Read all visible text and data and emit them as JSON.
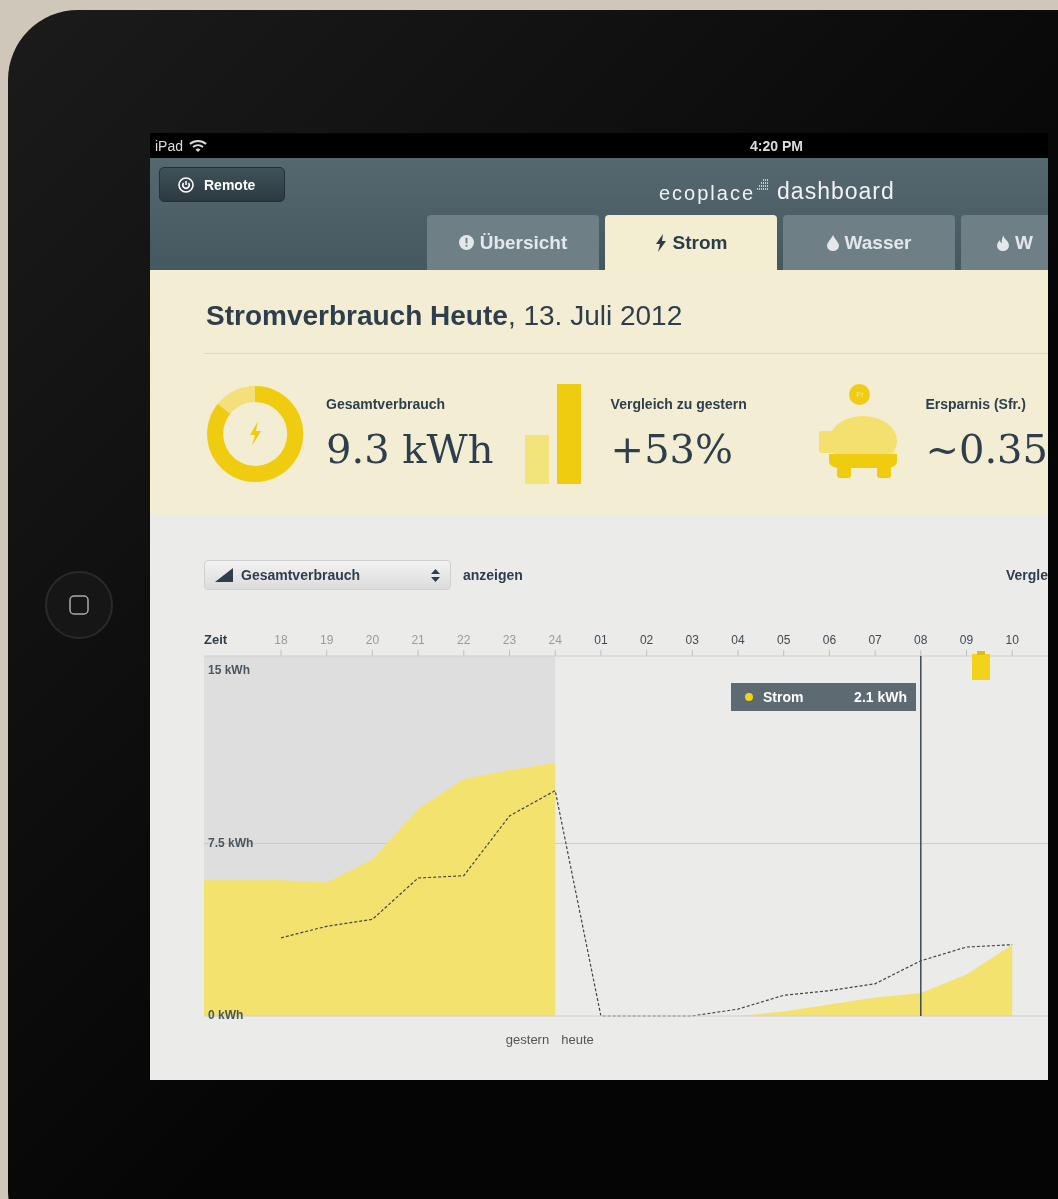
{
  "status_bar": {
    "device": "iPad",
    "time": "4:20 PM"
  },
  "header": {
    "remote_button": "Remote",
    "logo": {
      "brand": "ecoplace",
      "product": "dashboard"
    }
  },
  "tabs": [
    {
      "label": "Übersicht",
      "kind": "info",
      "selected": false
    },
    {
      "label": "Strom",
      "kind": "power",
      "selected": true
    },
    {
      "label": "Wasser",
      "kind": "water",
      "selected": false
    },
    {
      "label": "W",
      "kind": "fire",
      "selected": false
    }
  ],
  "summary": {
    "title": "**Stromverbrauch Heute**, 13. Juli 2012",
    "kpis": [
      {
        "kind": "donut",
        "label": "Gesamtverbrauch",
        "value": "9.3 kWh"
      },
      {
        "kind": "bars",
        "label": "Vergleich zu gestern",
        "value": "+53%"
      },
      {
        "kind": "piggy",
        "label": "Ersparnis (Sfr.)",
        "value": "~0.35",
        "coin_label": "Fr"
      }
    ]
  },
  "controls": {
    "select": "Gesamtverbrauch",
    "select_suffix": "anzeigen",
    "right_label": "Vergle"
  },
  "chart": {
    "tooltip": {
      "value": "2.1 kWh",
      "color": "#f2d21a"
    },
    "period_labels": {
      "previous": "gestern",
      "current": "heute"
    },
    "chart_data": {
      "type": "area",
      "xlabel": "Zeit",
      "categories": [
        "18",
        "19",
        "20",
        "21",
        "22",
        "23",
        "24",
        "01",
        "02",
        "03",
        "04",
        "05",
        "06",
        "07",
        "08",
        "09",
        "10"
      ],
      "series": [
        {
          "name": "Strom",
          "color": "#f3e36e",
          "values": [
            5.9,
            5.8,
            6.8,
            9.0,
            10.3,
            10.7,
            11.0,
            null,
            null,
            null,
            0,
            0.2,
            0.5,
            0.8,
            1.0,
            1.8,
            3.1
          ]
        },
        {
          "type": "line",
          "line_style": "dashed",
          "color": "#444444",
          "values": [
            3.4,
            3.9,
            4.2,
            6.0,
            6.1,
            8.7,
            9.8,
            0,
            0,
            0,
            0.3,
            0.9,
            1.1,
            1.4,
            2.4,
            3.0,
            3.1
          ]
        }
      ],
      "ref_lines": [
        {
          "axis": "x",
          "value": "08",
          "color": "#3e4a54"
        },
        {
          "axis": "y",
          "value": 7.5,
          "color": "#c9ccd0"
        }
      ],
      "ylim": [
        0,
        15
      ],
      "yticks": [
        {
          "value": 0,
          "label": "0 kWh"
        },
        {
          "value": 7.5,
          "label": "7.5 kWh"
        },
        {
          "value": 15,
          "label": "15 kWh"
        }
      ]
    }
  }
}
